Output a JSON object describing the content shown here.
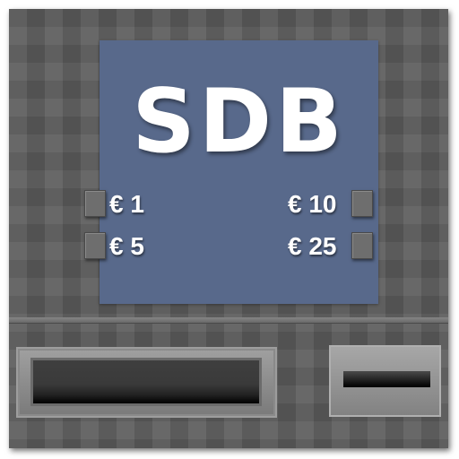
{
  "machine": {
    "logo_text": "SDB",
    "panel_color": "#58698b",
    "coins": [
      {
        "label": "€ 1"
      },
      {
        "label": "€ 5"
      },
      {
        "label": "€ 10"
      },
      {
        "label": "€ 25"
      }
    ],
    "icons": {
      "coin_buttons": "square-button-icon",
      "large_slot": "dispenser-slot-icon",
      "small_slot": "coin-slot-icon"
    }
  }
}
